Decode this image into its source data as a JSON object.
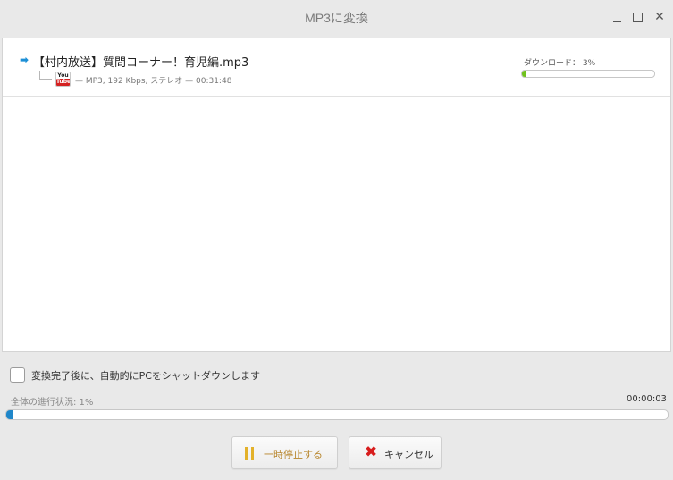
{
  "window": {
    "title": "MP3に変換",
    "minimize_icon": "minimize-icon",
    "maximize_icon": "maximize-icon",
    "close_icon": "close-icon",
    "close_glyph": "✕"
  },
  "list": {
    "items": [
      {
        "arrow_glyph": "➡",
        "filename": "【村内放送】質問コーナー！育児編.mp3",
        "source_icon": "youtube-icon",
        "source_top": "You",
        "source_bottom": "Tube",
        "meta": "— MP3, 192 Kbps, ステレオ — 00:31:48",
        "status_label": "ダウンロード：  3%",
        "progress": 0.03,
        "progress_color": "#70c21c"
      }
    ]
  },
  "shutdown": {
    "label": "変換完了後に、自動的にPCをシャットダウンします",
    "checked": false
  },
  "overall": {
    "label": "全体の進行状況: 1%",
    "time": "00:00:03",
    "progress": 0.01,
    "progress_color": "#1f86c9"
  },
  "buttons": {
    "pause_label": "一時停止する",
    "pause_icon": "pause-icon",
    "cancel_label": "キャンセル",
    "cancel_icon": "x-icon",
    "cancel_glyph": "✖"
  }
}
